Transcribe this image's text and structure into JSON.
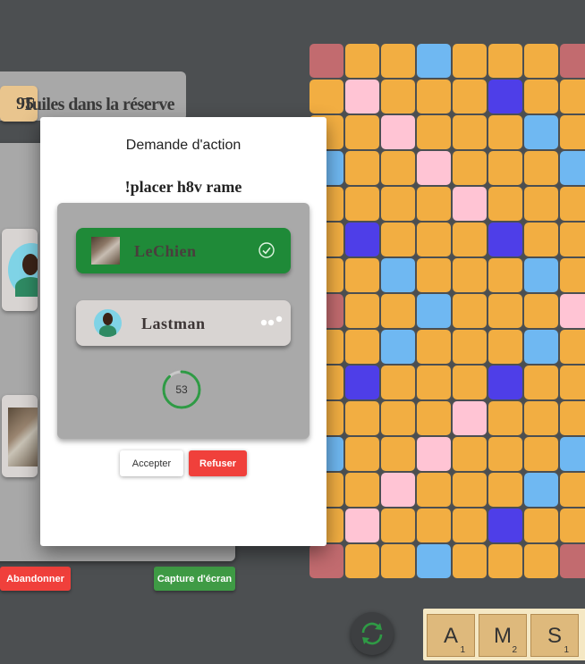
{
  "reserve": {
    "count": "95",
    "label": "Tuiles dans la réserve"
  },
  "game_actions": {
    "abandon_label": "Abandonner",
    "screenshot_label": "Capture d'écran"
  },
  "modal": {
    "title": "Demande d'action",
    "command": "!placer h8v rame",
    "players": [
      {
        "name": "LeChien",
        "status": "accepted",
        "status_icon": "check-circle-icon"
      },
      {
        "name": "Lastman",
        "status": "pending",
        "status_icon": "typing-dots-icon"
      }
    ],
    "timer": {
      "value": "53",
      "progress": 0.88
    },
    "accept_label": "Accepter",
    "refuse_label": "Refuser"
  },
  "board": {
    "rows": [
      [
        "tw",
        "n",
        "n",
        "dl",
        "n",
        "n",
        "n",
        "tw"
      ],
      [
        "n",
        "dw",
        "n",
        "n",
        "n",
        "tl",
        "n",
        "n"
      ],
      [
        "n",
        "n",
        "dw",
        "n",
        "n",
        "n",
        "dl",
        "n"
      ],
      [
        "dl",
        "n",
        "n",
        "dw",
        "n",
        "n",
        "n",
        "dl"
      ],
      [
        "n",
        "n",
        "n",
        "n",
        "dw",
        "n",
        "n",
        "n"
      ],
      [
        "n",
        "tl",
        "n",
        "n",
        "n",
        "tl",
        "n",
        "n"
      ],
      [
        "n",
        "n",
        "dl",
        "n",
        "n",
        "n",
        "dl",
        "n"
      ],
      [
        "tw",
        "n",
        "n",
        "dl",
        "n",
        "n",
        "n",
        "dw"
      ],
      [
        "n",
        "n",
        "dl",
        "n",
        "n",
        "n",
        "dl",
        "n"
      ],
      [
        "n",
        "tl",
        "n",
        "n",
        "n",
        "tl",
        "n",
        "n"
      ],
      [
        "n",
        "n",
        "n",
        "n",
        "dw",
        "n",
        "n",
        "n"
      ],
      [
        "dl",
        "n",
        "n",
        "dw",
        "n",
        "n",
        "n",
        "dl"
      ],
      [
        "n",
        "n",
        "dw",
        "n",
        "n",
        "n",
        "dl",
        "n"
      ],
      [
        "n",
        "dw",
        "n",
        "n",
        "n",
        "tl",
        "n",
        "n"
      ],
      [
        "tw",
        "n",
        "n",
        "dl",
        "n",
        "n",
        "n",
        "tw"
      ]
    ],
    "colors": {
      "n": "#f2ae42",
      "dw": "#ffc4d4",
      "tw": "#c26b6f",
      "dl": "#6fb8f2",
      "tl": "#4e3ee8"
    }
  },
  "rack": {
    "tiles": [
      {
        "letter": "A",
        "value": "1"
      },
      {
        "letter": "M",
        "value": "2"
      },
      {
        "letter": "S",
        "value": "1"
      }
    ]
  },
  "colors": {
    "accept_green": "#1f8a38",
    "refuse_red": "#f0403b",
    "capture_green": "#3f9b45"
  }
}
